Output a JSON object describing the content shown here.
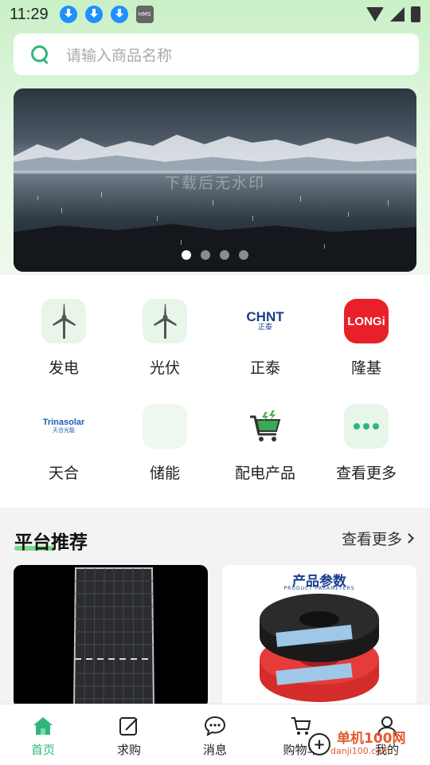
{
  "status_bar": {
    "time": "11:29",
    "hms_label": "HMS"
  },
  "search": {
    "placeholder": "请输入商品名称"
  },
  "banner": {
    "watermark_text": "下载后无水印",
    "dot_count": 4,
    "active_dot": 0
  },
  "categories": [
    {
      "label": "发电",
      "icon": "wind-turbine-icon"
    },
    {
      "label": "光伏",
      "icon": "wind-turbine-icon"
    },
    {
      "label": "正泰",
      "icon": "chint-logo-icon",
      "logo_text": "CHNT",
      "logo_sub": "正泰"
    },
    {
      "label": "隆基",
      "icon": "longi-logo-icon",
      "logo_text": "LONGi"
    },
    {
      "label": "天合",
      "icon": "trina-logo-icon",
      "logo_text": "Trinasolar",
      "logo_sub": "天合光能"
    },
    {
      "label": "储能",
      "icon": "blank-icon"
    },
    {
      "label": "配电产品",
      "icon": "shopping-cart-icon"
    },
    {
      "label": "查看更多",
      "icon": "more-dots-icon"
    }
  ],
  "recommend": {
    "title": "平台推荐",
    "more_label": "查看更多",
    "products": [
      {
        "image": "solar-panel"
      },
      {
        "image": "cable-coils",
        "title": "产品参数",
        "subtitle": "PRODUCT PARAMETERS"
      }
    ]
  },
  "bottom_nav": [
    {
      "label": "首页",
      "icon": "home-icon",
      "active": true
    },
    {
      "label": "求购",
      "icon": "edit-icon",
      "active": false
    },
    {
      "label": "消息",
      "icon": "chat-icon",
      "active": false
    },
    {
      "label": "购物车",
      "icon": "cart-icon",
      "active": false
    },
    {
      "label": "我的",
      "icon": "user-icon",
      "active": false
    }
  ],
  "watermark": {
    "text": "单机100网",
    "sub": "danji100.com"
  },
  "colors": {
    "accent": "#2db77b",
    "longi_red": "#e8202a",
    "chint_blue": "#1a3e8c"
  }
}
